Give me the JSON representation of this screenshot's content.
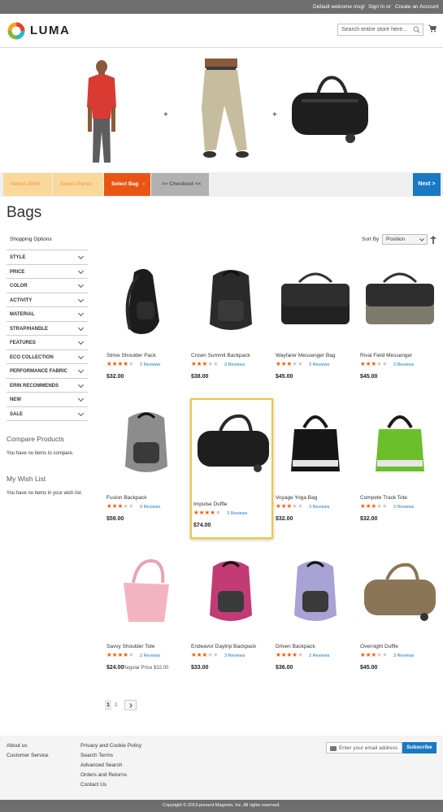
{
  "topbar": {
    "welcome": "Default welcome msg!",
    "sign_in": "Sign In",
    "or": "or",
    "create_account": "Create an Account"
  },
  "header": {
    "logo_text": "LUMA",
    "search_placeholder": "Search entire store here..."
  },
  "banner": {
    "plus": "+"
  },
  "steps": [
    {
      "label": "Select Shirt",
      "bg": "#f9d99b",
      "color": "#f4a25a"
    },
    {
      "label": "Select Pants",
      "bg": "#f9d99b",
      "color": "#f4a25a"
    },
    {
      "label": "Select Bag",
      "bg": "#ea5514",
      "color": "#ffffff"
    },
    {
      "label": ">> Checkout <<",
      "bg": "#b1b1b1",
      "color": "#555555"
    }
  ],
  "next_label": "Next >",
  "page_title": "Bags",
  "sidebar": {
    "shopping_options": "Shopping Options",
    "filters": [
      "STYLE",
      "PRICE",
      "COLOR",
      "ACTIVITY",
      "MATERIAL",
      "STRAP/HANDLE",
      "FEATURES",
      "ECO COLLECTION",
      "PERFORMANCE FABRIC",
      "ERIN RECOMMENDS",
      "NEW",
      "SALE"
    ],
    "compare_title": "Compare Products",
    "compare_text": "You have no items to compare.",
    "wishlist_title": "My Wish List",
    "wishlist_text": "You have no items in your wish list."
  },
  "toolbar": {
    "sort_by": "Sort By",
    "sort_value": "Position"
  },
  "products": [
    {
      "name": "Strive Shoulder Pack",
      "rating": 4,
      "reviews": "2  Reviews",
      "price": "$32.00",
      "icon": "sling-backpack"
    },
    {
      "name": "Crown Summit Backpack",
      "rating": 3,
      "reviews": "3  Reviews",
      "price": "$38.00",
      "icon": "backpack"
    },
    {
      "name": "Wayfarer Messenger Bag",
      "rating": 3,
      "reviews": "3  Reviews",
      "price": "$45.00",
      "icon": "messenger-bag"
    },
    {
      "name": "Rival Field Messenger",
      "rating": 3,
      "reviews": "2  Reviews",
      "price": "$45.00",
      "icon": "messenger-bag"
    },
    {
      "name": "Fusion Backpack",
      "rating": 3,
      "reviews": "3  Reviews",
      "price": "$59.00",
      "icon": "backpack"
    },
    {
      "name": "Impulse Duffle",
      "rating": 4,
      "reviews": "3  Reviews",
      "price": "$74.00",
      "icon": "duffle-bag"
    },
    {
      "name": "Voyage Yoga Bag",
      "rating": 3,
      "reviews": "3  Reviews",
      "price": "$32.00",
      "icon": "tote-bag"
    },
    {
      "name": "Compete Track Tote",
      "rating": 3,
      "reviews": "2  Reviews",
      "price": "$32.00",
      "icon": "tote-bag"
    },
    {
      "name": "Savvy Shoulder Tote",
      "rating": 4,
      "reviews": "2  Reviews",
      "price": "$24.00",
      "regular": "Regular Price  $32.00",
      "icon": "shoulder-tote"
    },
    {
      "name": "Endeavor Daytrip Backpack",
      "rating": 3,
      "reviews": "3  Reviews",
      "price": "$33.00",
      "icon": "backpack"
    },
    {
      "name": "Driven Backpack",
      "rating": 4,
      "reviews": "2  Reviews",
      "price": "$36.00",
      "icon": "backpack"
    },
    {
      "name": "Overnight Duffle",
      "rating": 3,
      "reviews": "3  Reviews",
      "price": "$45.00",
      "icon": "duffle-bag"
    }
  ],
  "pager": {
    "page1": "1",
    "page2": "2"
  },
  "footer": {
    "col1": [
      "About us",
      "Customer Service"
    ],
    "col2": [
      "Privacy and Cookie Policy",
      "Search Terms",
      "Advanced Search",
      "Orders and Returns",
      "Contact Us"
    ],
    "newsletter_placeholder": "Enter your email address",
    "subscribe": "Subscribe"
  },
  "copyright": "Copyright © 2013-present Magento, Inc. All rights reserved.",
  "colors": {
    "accent_blue": "#1979c3",
    "star_orange": "#ff5501",
    "highlight_yellow": "#f0c53a"
  }
}
